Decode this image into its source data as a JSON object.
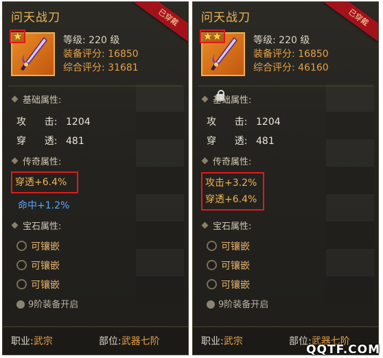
{
  "cards": [
    {
      "name": "问天战刀",
      "worn_badge": "已穿戴",
      "stars": "★",
      "level_label": "等级:",
      "level_value": "220 级",
      "equip_score_label": "装备评分:",
      "equip_score": "16850",
      "total_score_label": "综合评分:",
      "total_score": "31681",
      "base_section": "基础属性:",
      "base_attrs": [
        {
          "key": "攻      击:",
          "value": "1204"
        },
        {
          "key": "穿      透:",
          "value": "481"
        }
      ],
      "legend_section": "传奇属性:",
      "legend_boxed": [
        "穿透+6.4%"
      ],
      "legend_extra": "命中+1.2%",
      "gem_section": "宝石属性:",
      "gems": [
        "可镶嵌",
        "可镶嵌",
        "可镶嵌"
      ],
      "unlock_text": "9阶装备开启",
      "class_label": "职业:",
      "class_value": "武宗",
      "slot_label": "部位:",
      "slot_value": "武器七阶"
    },
    {
      "name": "问天战刀",
      "worn_badge": "已穿戴",
      "stars": "★★",
      "level_label": "等级:",
      "level_value": "220 级",
      "equip_score_label": "装备评分:",
      "equip_score": "16850",
      "total_score_label": "综合评分:",
      "total_score": "46160",
      "base_section": "基础属性:",
      "base_attrs": [
        {
          "key": "攻      击:",
          "value": "1204"
        },
        {
          "key": "穿      透:",
          "value": "481"
        }
      ],
      "legend_section": "传奇属性:",
      "legend_boxed": [
        "攻击+3.2%",
        "穿透+6.4%"
      ],
      "gem_section": "宝石属性:",
      "gems": [
        "可镶嵌",
        "可镶嵌",
        "可镶嵌"
      ],
      "unlock_text": "9阶装备开启",
      "class_label": "职业:",
      "class_value": "武宗",
      "slot_label": "部位:",
      "slot_value": "武器七阶"
    }
  ],
  "watermark": "QQTF.COM",
  "colors": {
    "accent": "#e8a248",
    "highlight_box": "#e21a1a",
    "blue_attr": "#59a8ff",
    "ribbon": "#a3121a"
  }
}
